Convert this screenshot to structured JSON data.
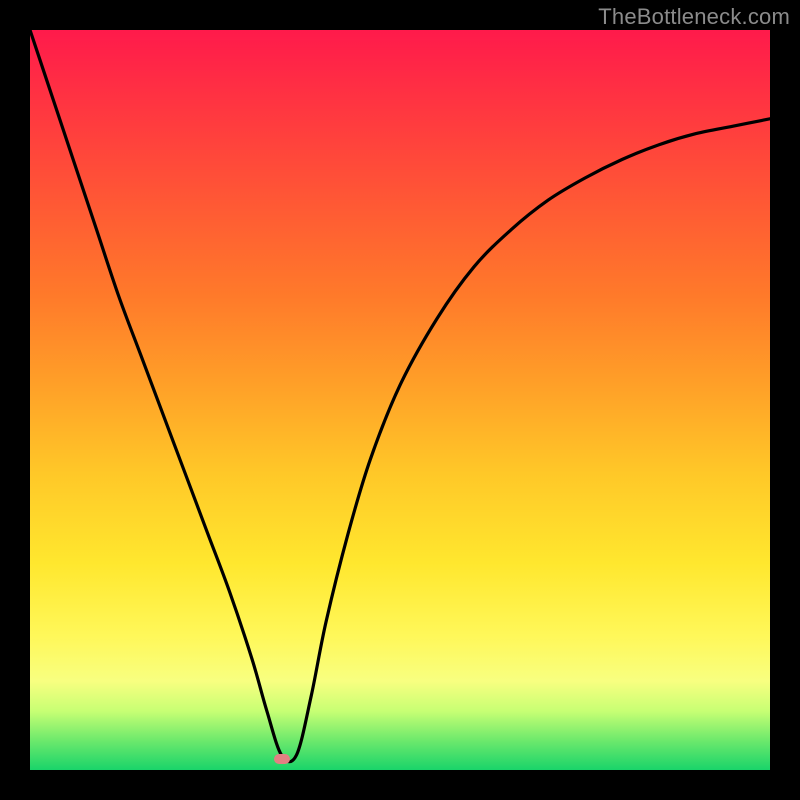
{
  "attribution": "TheBottleneck.com",
  "marker": {
    "x_pct": 34.0,
    "y_pct": 98.5
  },
  "colors": {
    "background": "#000000",
    "curve": "#000000",
    "marker": "#e28083",
    "attribution_text": "#8b8b8b",
    "gradient_stops": [
      "#ff1a4b",
      "#ff3a3f",
      "#ff5a34",
      "#ff7a2a",
      "#ffa028",
      "#ffc828",
      "#ffe72e",
      "#fff85a",
      "#f8ff80",
      "#c8ff74",
      "#6de96c",
      "#19d46a"
    ]
  },
  "chart_data": {
    "type": "line",
    "title": "",
    "xlabel": "",
    "ylabel": "",
    "x_range_pct": [
      0,
      100
    ],
    "y_range_pct": [
      0,
      100
    ],
    "notes": "Values are percentages within the plot area; x left→right, y bottom→top. Single V-shaped curve with minimum near x≈34%.",
    "series": [
      {
        "name": "bottleneck-curve",
        "x": [
          0,
          3,
          6,
          9,
          12,
          15,
          18,
          21,
          24,
          27,
          30,
          32,
          34,
          36,
          38,
          40,
          43,
          46,
          50,
          55,
          60,
          65,
          70,
          75,
          80,
          85,
          90,
          95,
          100
        ],
        "y": [
          100,
          91,
          82,
          73,
          64,
          56,
          48,
          40,
          32,
          24,
          15,
          8,
          2,
          2,
          10,
          20,
          32,
          42,
          52,
          61,
          68,
          73,
          77,
          80,
          82.5,
          84.5,
          86,
          87,
          88
        ]
      }
    ],
    "marker_point": {
      "x": 34,
      "y": 1.5,
      "label": ""
    }
  }
}
